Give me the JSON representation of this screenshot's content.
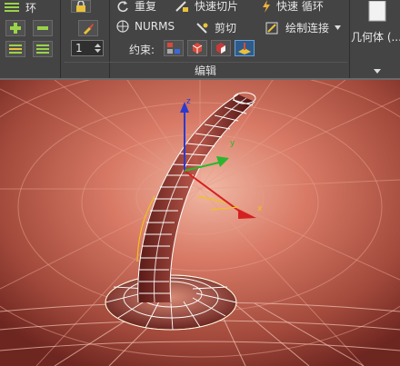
{
  "ribbon": {
    "ring_label": "环",
    "spinner_value": "1",
    "repeat_label": "重复",
    "quick_slice_label": "快速切片",
    "quick_loop_label": "快速 循环",
    "nurms_label": "NURMS",
    "cut_label": "剪切",
    "paint_connect_label": "绘制连接",
    "constraints_label": "约束:",
    "group_label": "编辑",
    "geometry_label": "几何体 (..."
  },
  "colors": {
    "ribbon_bg": "#444444",
    "viewport_bg": "#8a3b33",
    "wire_white": "#ffffff",
    "wire_yellow": "#f0c21a",
    "axis_x": "#d42020",
    "axis_y": "#2db52d",
    "axis_z": "#2a3ad0"
  }
}
